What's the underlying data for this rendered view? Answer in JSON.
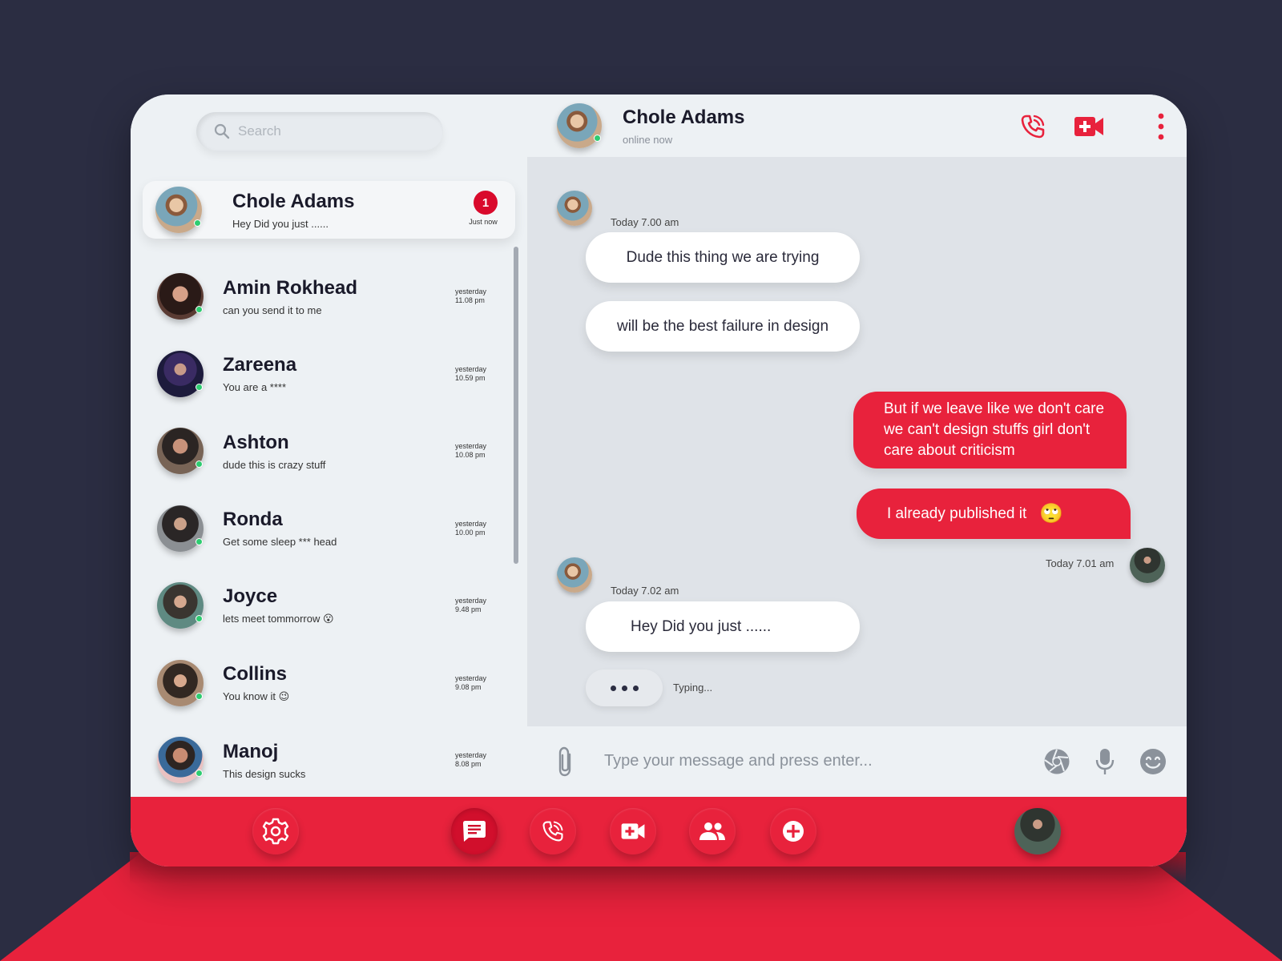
{
  "colors": {
    "accent": "#e8223c",
    "badge": "#d90a2c",
    "online": "#2ecc71",
    "backdrop": "#2b2d42"
  },
  "search": {
    "placeholder": "Search"
  },
  "contacts": [
    {
      "name": "Chole Adams",
      "message": "Hey Did you just ......",
      "time": "Just now",
      "unread": "1",
      "active": true
    },
    {
      "name": "Amin Rokhead",
      "message": "can you send it to me",
      "time_day": "yesterday",
      "time": "11.08 pm"
    },
    {
      "name": "Zareena",
      "message": "You are a ****",
      "time_day": "yesterday",
      "time": "10.59 pm"
    },
    {
      "name": "Ashton",
      "message": "dude this is crazy stuff",
      "time_day": "yesterday",
      "time": "10.08 pm"
    },
    {
      "name": "Ronda",
      "message": "Get some sleep *** head",
      "time_day": "yesterday",
      "time": "10.00 pm"
    },
    {
      "name": "Joyce",
      "message": "lets meet tommorrow",
      "emoji": "😮",
      "time_day": "yesterday",
      "time": "9.48 pm"
    },
    {
      "name": "Collins",
      "message": "You know it",
      "emoji": "😉",
      "time_day": "yesterday",
      "time": "9.08 pm"
    },
    {
      "name": "Manoj",
      "message": "This design sucks",
      "time_day": "yesterday",
      "time": "8.08 pm"
    }
  ],
  "chat": {
    "name": "Chole Adams",
    "status": "online now",
    "messages": [
      {
        "direction": "in",
        "stamp": "Today 7.00 am",
        "text": "Dude this thing we are trying"
      },
      {
        "direction": "in",
        "text": "will be the best failure in design"
      },
      {
        "direction": "out",
        "text": "But if we leave like we don't care we can't design stuffs girl don't care about criticism"
      },
      {
        "direction": "out",
        "text": "I already published it",
        "emoji": "🙄",
        "stamp": "Today 7.01 am"
      },
      {
        "direction": "in",
        "stamp": "Today 7.02 am",
        "text": "Hey Did you just ......"
      }
    ],
    "typing": "Typing..."
  },
  "composer": {
    "placeholder": "Type your message and press enter..."
  },
  "icons": {
    "header": [
      "phone-call-icon",
      "video-camera-icon",
      "more-vertical-icon"
    ],
    "composer": [
      "paperclip-icon",
      "camera-shutter-icon",
      "microphone-icon",
      "smiley-icon"
    ],
    "bottom_bar": [
      "settings-gear-icon",
      "chat-bubble-icon",
      "phone-icon",
      "video-icon",
      "people-icon",
      "plus-circle-icon"
    ]
  }
}
